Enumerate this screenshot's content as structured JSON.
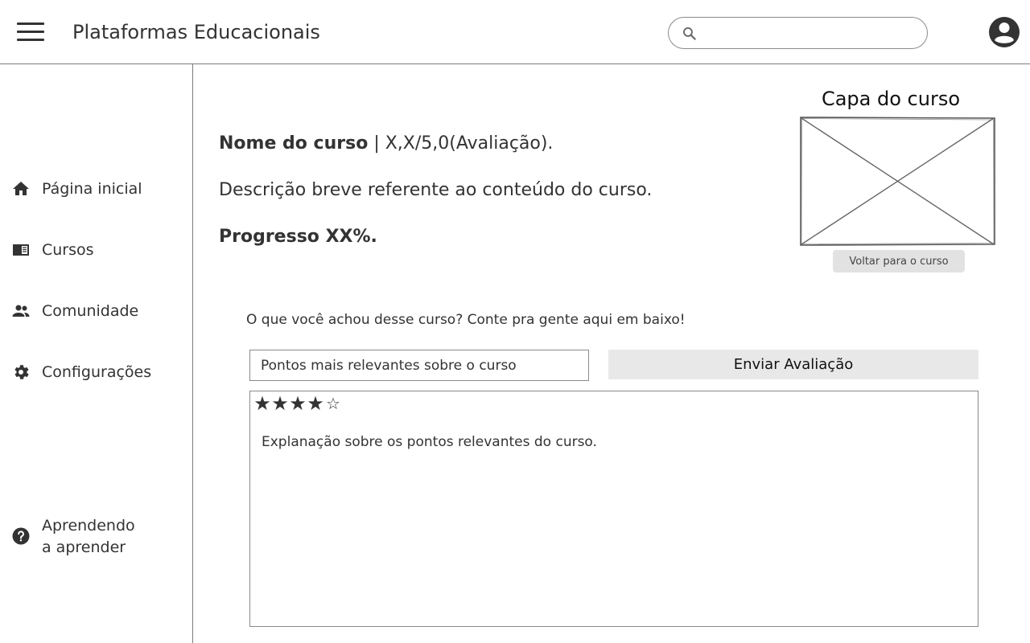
{
  "header": {
    "title": "Plataformas Educacionais",
    "search": {
      "placeholder": "",
      "value": ""
    },
    "icons": {
      "menu": "hamburger-menu-icon",
      "search": "search-icon",
      "account": "account-circle-icon"
    }
  },
  "sidebar": {
    "items": [
      {
        "label": "Página inicial",
        "icon": "home-icon"
      },
      {
        "label": "Cursos",
        "icon": "courses-book-icon"
      },
      {
        "label": "Comunidade",
        "icon": "people-icon"
      },
      {
        "label": "Configurações",
        "icon": "gear-icon"
      }
    ],
    "help": {
      "line1": "Aprendendo",
      "line2": "a aprender",
      "icon": "help-circle-icon"
    }
  },
  "course": {
    "name": "Nome do curso",
    "rating_text": " | X,X/5,0(Avaliação).",
    "description": "Descrição breve referente  ao conteúdo do curso.",
    "progress": "Progresso XX%.",
    "cover_title": "Capa do curso",
    "back_button": "Voltar para o curso"
  },
  "review": {
    "prompt": "O que você achou desse curso? Conte pra gente aqui em baixo!",
    "points_value": "Pontos mais relevantes sobre o curso",
    "submit_label": "Enviar Avaliação",
    "rating": 4,
    "max_rating": 5,
    "text": "Explanação sobre os pontos relevantes do curso."
  },
  "colors": {
    "text": "#333333",
    "border": "#8a8a8a",
    "button_bg": "#e8e8e8"
  }
}
